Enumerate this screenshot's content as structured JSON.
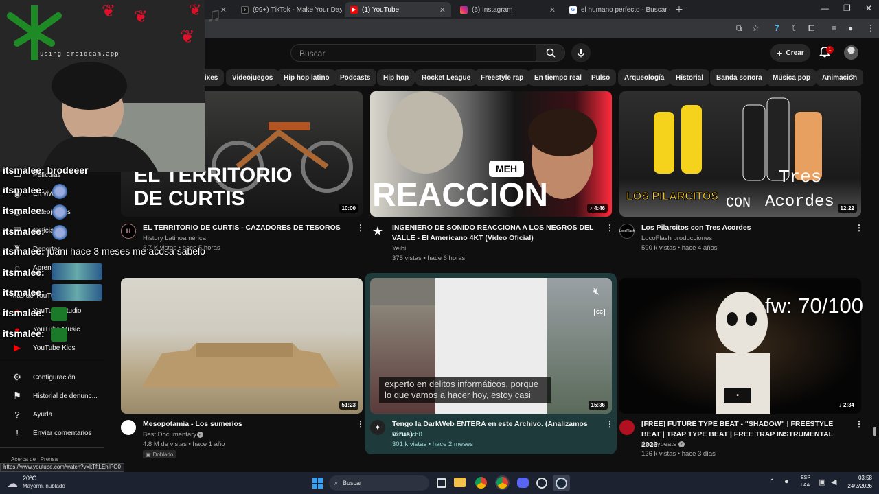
{
  "browser": {
    "tabs": [
      {
        "label": "",
        "color": "#ffffff"
      },
      {
        "label": "",
        "color": "#ffffff"
      },
      {
        "label": "",
        "color": "#ffffff"
      },
      {
        "label": "(99+) TikTok - Make Your Day",
        "color": "#111111"
      },
      {
        "label": "(1) YouTube",
        "color": "#ff0000"
      },
      {
        "label": "(6) Instagram",
        "color": "#d62976"
      },
      {
        "label": "el humano perfecto - Buscar co",
        "color": "#4285f4"
      }
    ]
  },
  "header": {
    "search_placeholder": "Buscar",
    "create_label": "Crear",
    "notif_count": "1"
  },
  "chips": [
    "mixes",
    "Videojuegos",
    "Hip hop latino",
    "Podcasts",
    "Hip hop",
    "Rocket League",
    "Freestyle rap",
    "En tiempo real",
    "Pulso",
    "Arqueología",
    "Historial",
    "Banda sonora",
    "Música pop",
    "Animación"
  ],
  "sidebar": {
    "items": [
      "Películas",
      "En vivo",
      "Videojuegos",
      "Noticias",
      "Deportes",
      "Aprender",
      "Más de YouTube",
      "YouTube Studio",
      "YouTube Music",
      "YouTube Kids",
      "Configuración",
      "Historial de denunc...",
      "Ayuda",
      "Enviar comentarios"
    ],
    "footer": "Acerca de   Prensa"
  },
  "videos": [
    {
      "title": "EL TERRITORIO DE CURTIS  - CAZADORES DE TESOROS",
      "channel": "History Latinoamérica",
      "meta": "3.7 K vistas • hace 5 horas",
      "duration": "10:00",
      "thumb_text": "EL TERRITORIO\nDE CURTIS"
    },
    {
      "title": "INGENIERO DE SONIDO REACCIONA A LOS NEGROS DEL VALLE - El Americano 4KT (Video Oficial)",
      "channel": "Yeibi",
      "meta": "375 vistas • hace 6 horas",
      "duration": "♪ 4:46",
      "thumb_text": "REACCION",
      "thumb_tag": "MEH"
    },
    {
      "title": "Los Pilarcitos con Tres Acordes",
      "channel": "LocoFlash producciones",
      "meta": "590 k vistas • hace 4 años",
      "duration": "12:22",
      "thumb_text_a": "LOS PILARCITOS",
      "thumb_text_b": "Tres",
      "thumb_text_c": "CON",
      "thumb_text_d": "Acordes"
    },
    {
      "title": "Mesopotamia - Los sumerios",
      "channel": "Best Documentary",
      "meta": "4.8 M de vistas • hace 1 año",
      "duration": "51:23",
      "badge": "Doblado"
    },
    {
      "title": "Tengo la DarkWeb ENTERA en este Archivo. (Analizamos Virus)",
      "channel": "0xFaluch0",
      "meta": "301 k vistas • hace 2 meses",
      "duration": "15:36",
      "caption": "experto en delitos informáticos, porque\nlo que vamos a hacer hoy, estoy casi"
    },
    {
      "title": "[FREE] FUTURE TYPE BEAT - \"SHADOW\" | FREESTYLE BEAT | TRAP TYPE BEAT | FREE TRAP INSTRUMENTAL 2026",
      "channel": "theskybeats",
      "meta": "126 k vistas • hace 3 días",
      "duration": "♪ 2:34"
    }
  ],
  "overlay": {
    "cam_label": "using droidcam.app",
    "chat": [
      {
        "user": "itsmalee:",
        "text": "brodeeer"
      },
      {
        "user": "itsmalee:",
        "text": ""
      },
      {
        "user": "itsmalee:",
        "text": ""
      },
      {
        "user": "itsmalee:",
        "text": ""
      },
      {
        "user": "itsmalee:",
        "text": "juani hace 3 meses me acosa sabelo"
      },
      {
        "user": "itsmalee:",
        "text": ""
      },
      {
        "user": "itsmalee:",
        "text": ""
      },
      {
        "user": "itsmalee:",
        "text": ""
      },
      {
        "user": "itsmalee:",
        "text": ""
      }
    ],
    "fw": "fw: 70/100"
  },
  "status_url": "https://www.youtube.com/watch?v=kTftLEhIPO0",
  "taskbar": {
    "weather_temp": "20°C",
    "weather_desc": "Mayorm. nublado",
    "search": "Buscar",
    "lang_a": "ESP",
    "lang_b": "LAA",
    "time": "03:58",
    "date": "24/2/2026"
  }
}
